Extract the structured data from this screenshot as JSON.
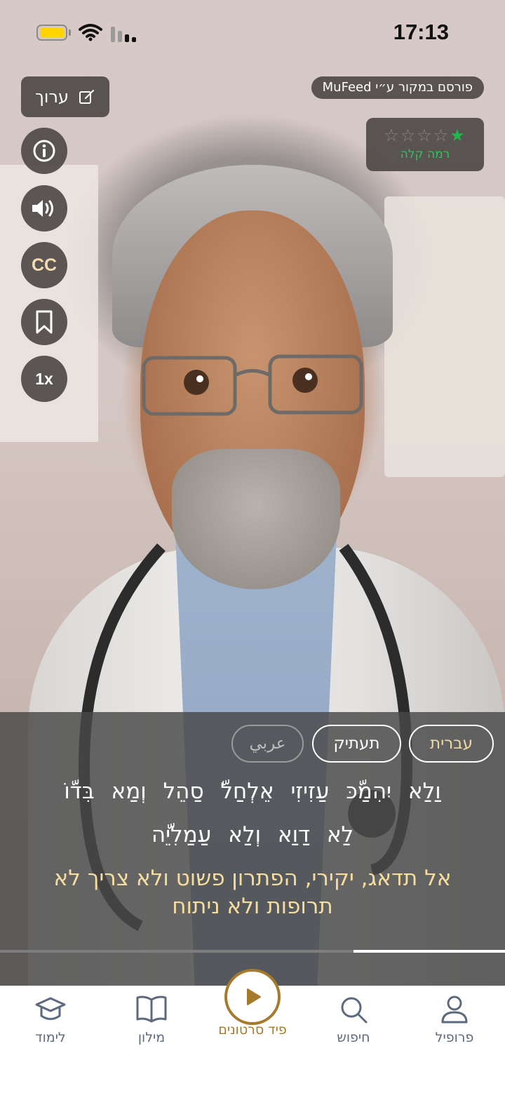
{
  "status_bar": {
    "time": "17:13"
  },
  "overlay": {
    "edit_label": "ערוך",
    "source_label": "פורסם במקור ע״י MuFeed",
    "level": {
      "stars_filled": 1,
      "stars_total": 5,
      "label": "רמה קלה"
    },
    "speed_label": "1x",
    "cc_label": "CC"
  },
  "subtitles": {
    "tabs": {
      "hebrew": "עברית",
      "transliteration": "תעתיק",
      "arabic": "عربي"
    },
    "arabic_line1": "וַלַא יִהִמַّכּ עַזִיזִי אֵלְחַלّ סַהֵל וְמַא בִּדّוֹ",
    "arabic_line2": "לַא דַוַא וְלַא עַמַלִיֵّה",
    "hebrew_translation": "אל תדאג, יקירי, הפתרון פשוט ולא צריך לא תרופות ולא ניתוח"
  },
  "video": {
    "progress": 0.3
  },
  "tabbar": {
    "items": [
      {
        "label": "פרופיל",
        "icon": "person-icon"
      },
      {
        "label": "חיפוש",
        "icon": "search-icon"
      },
      {
        "label": "פיד סרטונים",
        "icon": "play-icon"
      },
      {
        "label": "מילון",
        "icon": "book-icon"
      },
      {
        "label": "לימוד",
        "icon": "graduation-cap-icon"
      }
    ],
    "active_index": 2
  },
  "colors": {
    "accent": "#a67a2c",
    "star_on": "#1db74a",
    "subtitle_yellow": "#f6dd9e"
  }
}
